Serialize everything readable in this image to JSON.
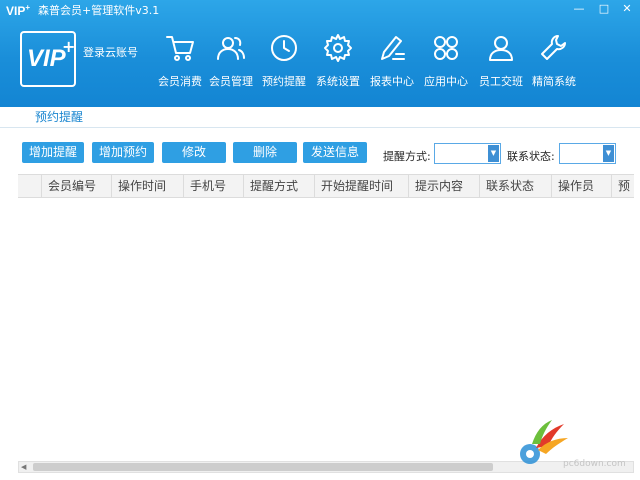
{
  "window": {
    "logo_mini": "VIP",
    "title": "森普会员+管理软件v3.1",
    "minimize_glyph": "—",
    "maximize_glyph": "□",
    "close_glyph": "✕"
  },
  "brand": {
    "logo_text": "VIP",
    "logo_plus": "+",
    "cloud_account": "登录云账号"
  },
  "nav": {
    "items": [
      {
        "label": "会员消费",
        "icon": "shopping-cart-icon"
      },
      {
        "label": "会员管理",
        "icon": "users-icon"
      },
      {
        "label": "预约提醒",
        "icon": "clock-icon"
      },
      {
        "label": "系统设置",
        "icon": "gear-icon"
      },
      {
        "label": "报表中心",
        "icon": "report-pen-icon"
      },
      {
        "label": "应用中心",
        "icon": "apps-grid-icon"
      },
      {
        "label": "员工交班",
        "icon": "user-icon"
      },
      {
        "label": "精简系统",
        "icon": "wrench-icon"
      }
    ]
  },
  "tabs": {
    "active": "预约提醒"
  },
  "toolbar": {
    "add_remind": "增加提醒",
    "add_appointment": "增加预约",
    "edit": "修改",
    "delete": "删除",
    "send_message": "发送信息"
  },
  "filters": {
    "remind_method_label": "提醒方式:",
    "remind_method_value": "",
    "contact_status_label": "联系状态:",
    "contact_status_value": ""
  },
  "table": {
    "columns": [
      "",
      "会员编号",
      "操作时间",
      "手机号",
      "提醒方式",
      "开始提醒时间",
      "提示内容",
      "联系状态",
      "操作员",
      "预"
    ],
    "rows": []
  },
  "watermark": {
    "text": "pc6down.com"
  },
  "colors": {
    "header_blue": "#1a8ed9",
    "button_blue": "#2f9fe3",
    "tab_text": "#1a86d0"
  }
}
